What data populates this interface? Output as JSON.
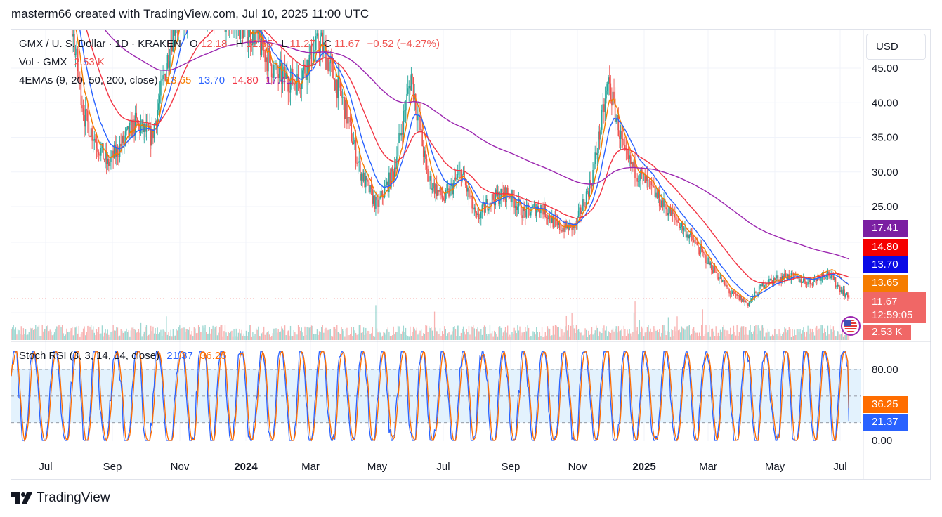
{
  "caption": "masterm66 created with TradingView.com, Jul 10, 2025 11:00 UTC",
  "brand": "TradingView",
  "currency": "USD",
  "legend": {
    "symbol": "GMX / U. S. Dollar · 1D · KRAKEN",
    "o_label": "O",
    "o_val": "12.18",
    "h_label": "H",
    "h_val": "12.55",
    "l_label": "L",
    "l_val": "11.27",
    "c_label": "C",
    "c_val": "11.67",
    "change": "−0.52 (−4.27%)",
    "vol_label": "Vol · GMX",
    "vol_val": "2.53 K",
    "ema_label": "4EMAs (9, 20, 50, 200, close)",
    "ema9": "13.65",
    "ema20": "13.70",
    "ema50": "14.80",
    "ema200": "17.41",
    "stoch_label": "Stoch RSI (3, 3, 14, 14, close)",
    "stoch_k": "21.37",
    "stoch_d": "36.25"
  },
  "badges": {
    "ema200": "17.41",
    "ema50": "14.80",
    "ema20": "13.70",
    "ema9": "13.65",
    "price": "11.67",
    "countdown": "12:59:05",
    "volume": "2.53 K",
    "stoch_d": "36.25",
    "stoch_k": "21.37"
  },
  "colors": {
    "up": "#26a69a",
    "down": "#ef5350",
    "ema9": "#f57c00",
    "ema20": "#2962ff",
    "ema50": "#f23645",
    "ema200": "#9c27b0",
    "stoch_k": "#2962ff",
    "stoch_d": "#ff6d00",
    "band": "#e3f2fd"
  },
  "chart_data": [
    {
      "type": "candlestick",
      "title": "GMX / U. S. Dollar · 1D · KRAKEN",
      "y_ticks": [
        45.0,
        40.0,
        35.0,
        30.0,
        25.0
      ],
      "x_ticks": [
        "Jul",
        "Sep",
        "Nov",
        "2024",
        "Mar",
        "May",
        "Jul",
        "Sep",
        "Nov",
        "2025",
        "Mar",
        "May",
        "Jul"
      ],
      "close_path": [
        [
          "2023-06-15",
          56
        ],
        [
          "2023-07-10",
          60
        ],
        [
          "2023-08-05",
          55
        ],
        [
          "2023-08-20",
          38
        ],
        [
          "2023-09-10",
          31
        ],
        [
          "2023-10-05",
          37
        ],
        [
          "2023-10-20",
          35
        ],
        [
          "2023-11-10",
          52
        ],
        [
          "2023-12-01",
          54
        ],
        [
          "2023-12-20",
          53
        ],
        [
          "2024-01-20",
          50
        ],
        [
          "2024-02-10",
          44
        ],
        [
          "2024-02-28",
          43
        ],
        [
          "2024-03-20",
          49
        ],
        [
          "2024-04-10",
          40
        ],
        [
          "2024-04-25",
          30
        ],
        [
          "2024-05-10",
          25
        ],
        [
          "2024-05-25",
          30
        ],
        [
          "2024-06-10",
          44
        ],
        [
          "2024-06-25",
          29
        ],
        [
          "2024-07-10",
          26
        ],
        [
          "2024-07-25",
          30
        ],
        [
          "2024-08-08",
          23
        ],
        [
          "2024-08-20",
          26
        ],
        [
          "2024-09-05",
          27
        ],
        [
          "2024-09-20",
          24
        ],
        [
          "2024-10-05",
          25
        ],
        [
          "2024-10-20",
          22
        ],
        [
          "2024-11-05",
          22
        ],
        [
          "2024-11-20",
          29
        ],
        [
          "2024-12-05",
          43
        ],
        [
          "2024-12-20",
          32
        ],
        [
          "2025-01-05",
          29
        ],
        [
          "2025-01-25",
          25
        ],
        [
          "2025-02-15",
          21
        ],
        [
          "2025-03-05",
          17
        ],
        [
          "2025-03-25",
          12.5
        ],
        [
          "2025-04-10",
          11
        ],
        [
          "2025-04-25",
          14
        ],
        [
          "2025-05-15",
          15
        ],
        [
          "2025-06-05",
          14
        ],
        [
          "2025-06-20",
          15.5
        ],
        [
          "2025-07-10",
          11.67
        ]
      ],
      "ema": {
        "ema9": 13.65,
        "ema20": 13.7,
        "ema50": 14.8,
        "ema200": 17.41
      },
      "last": {
        "open": 12.18,
        "high": 12.55,
        "low": 11.27,
        "close": 11.67,
        "volume": "2.53 K"
      }
    },
    {
      "type": "line",
      "title": "Stoch RSI (3, 3, 14, 14, close)",
      "y_ticks": [
        80.0,
        0.0
      ],
      "band": [
        20,
        80
      ],
      "series": [
        {
          "name": "K",
          "last": 21.37
        },
        {
          "name": "D",
          "last": 36.25
        }
      ]
    }
  ]
}
